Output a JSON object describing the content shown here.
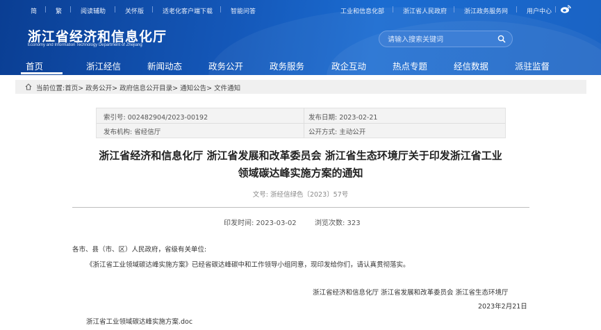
{
  "topbar": {
    "simplified": "简",
    "traditional": "繁",
    "reading_aid": "阅读辅助",
    "elder_mode": "关怀版",
    "client_download": "适老化客户端下载",
    "smart_q": "智能问答",
    "dept": "工业和信息化部",
    "gov": "浙江省人民政府",
    "service": "浙江政务服务网",
    "user_center": "用户中心"
  },
  "logo": {
    "title": "浙江省经济和信息化厅",
    "subtitle": "Economy and Information Technology Department of Zhejiang"
  },
  "search": {
    "placeholder": "请输入搜索关键词"
  },
  "nav": {
    "items": [
      {
        "label": "首页"
      },
      {
        "label": "浙江经信"
      },
      {
        "label": "新闻动态"
      },
      {
        "label": "政务公开"
      },
      {
        "label": "政务服务"
      },
      {
        "label": "政企互动"
      },
      {
        "label": "热点专题"
      },
      {
        "label": "经信数据"
      },
      {
        "label": "派驻监督"
      }
    ]
  },
  "breadcrumb": {
    "text": "当前位置:首页> 政务公开> 政府信息公开目录> 通知公告> 文件通知"
  },
  "info": {
    "index_no": "索引号: 002482904/2023-00192",
    "publish_date": "发布日期: 2023-02-21",
    "issuer": "发布机构: 省经信厅",
    "open_mode": "公开方式: 主动公开"
  },
  "document": {
    "title_line1": "浙江省经济和信息化厅 浙江省发展和改革委员会 浙江省生态环境厅关于印发浙江省工业",
    "title_line2": "领域碳达峰实施方案的通知",
    "doc_number": "文号: 浙经信绿色〔2023〕57号",
    "issue_time": "印发时间:  2023-03-02",
    "views": "浏览次数:  323",
    "salutation": "各市、县（市、区）人民政府，省级有关单位:",
    "paragraph": "《浙江省工业领域碳达峰实施方案》已经省碳达峰碳中和工作领导小组同意，现印发给你们，请认真贯彻落实。",
    "signatories": "浙江省经济和信息化厅    浙江省发展和改革委员会    浙江省生态环境厅",
    "sign_date": "2023年2月21日",
    "attachment": "浙江省工业领域碳达峰实施方案.doc"
  },
  "colors": {
    "header_blue": "#1457b8",
    "breadcrumb_bg": "#f0f0f0"
  }
}
